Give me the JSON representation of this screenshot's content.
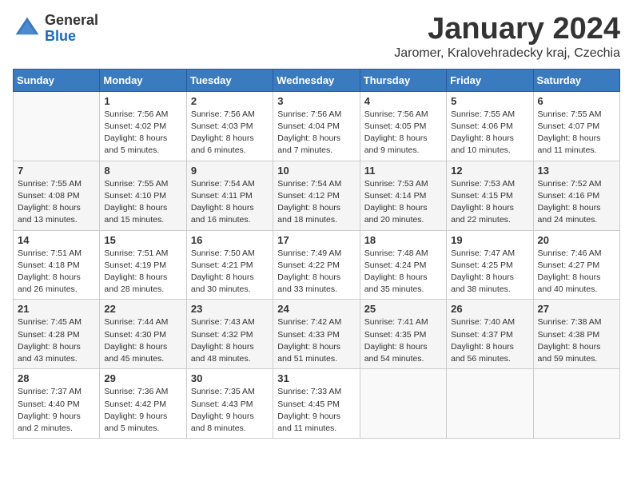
{
  "header": {
    "logo_general": "General",
    "logo_blue": "Blue",
    "title": "January 2024",
    "subtitle": "Jaromer, Kralovehradecky kraj, Czechia"
  },
  "calendar": {
    "days_of_week": [
      "Sunday",
      "Monday",
      "Tuesday",
      "Wednesday",
      "Thursday",
      "Friday",
      "Saturday"
    ],
    "weeks": [
      [
        {
          "day": "",
          "info": ""
        },
        {
          "day": "1",
          "info": "Sunrise: 7:56 AM\nSunset: 4:02 PM\nDaylight: 8 hours\nand 5 minutes."
        },
        {
          "day": "2",
          "info": "Sunrise: 7:56 AM\nSunset: 4:03 PM\nDaylight: 8 hours\nand 6 minutes."
        },
        {
          "day": "3",
          "info": "Sunrise: 7:56 AM\nSunset: 4:04 PM\nDaylight: 8 hours\nand 7 minutes."
        },
        {
          "day": "4",
          "info": "Sunrise: 7:56 AM\nSunset: 4:05 PM\nDaylight: 8 hours\nand 9 minutes."
        },
        {
          "day": "5",
          "info": "Sunrise: 7:55 AM\nSunset: 4:06 PM\nDaylight: 8 hours\nand 10 minutes."
        },
        {
          "day": "6",
          "info": "Sunrise: 7:55 AM\nSunset: 4:07 PM\nDaylight: 8 hours\nand 11 minutes."
        }
      ],
      [
        {
          "day": "7",
          "info": "Sunrise: 7:55 AM\nSunset: 4:08 PM\nDaylight: 8 hours\nand 13 minutes."
        },
        {
          "day": "8",
          "info": "Sunrise: 7:55 AM\nSunset: 4:10 PM\nDaylight: 8 hours\nand 15 minutes."
        },
        {
          "day": "9",
          "info": "Sunrise: 7:54 AM\nSunset: 4:11 PM\nDaylight: 8 hours\nand 16 minutes."
        },
        {
          "day": "10",
          "info": "Sunrise: 7:54 AM\nSunset: 4:12 PM\nDaylight: 8 hours\nand 18 minutes."
        },
        {
          "day": "11",
          "info": "Sunrise: 7:53 AM\nSunset: 4:14 PM\nDaylight: 8 hours\nand 20 minutes."
        },
        {
          "day": "12",
          "info": "Sunrise: 7:53 AM\nSunset: 4:15 PM\nDaylight: 8 hours\nand 22 minutes."
        },
        {
          "day": "13",
          "info": "Sunrise: 7:52 AM\nSunset: 4:16 PM\nDaylight: 8 hours\nand 24 minutes."
        }
      ],
      [
        {
          "day": "14",
          "info": "Sunrise: 7:51 AM\nSunset: 4:18 PM\nDaylight: 8 hours\nand 26 minutes."
        },
        {
          "day": "15",
          "info": "Sunrise: 7:51 AM\nSunset: 4:19 PM\nDaylight: 8 hours\nand 28 minutes."
        },
        {
          "day": "16",
          "info": "Sunrise: 7:50 AM\nSunset: 4:21 PM\nDaylight: 8 hours\nand 30 minutes."
        },
        {
          "day": "17",
          "info": "Sunrise: 7:49 AM\nSunset: 4:22 PM\nDaylight: 8 hours\nand 33 minutes."
        },
        {
          "day": "18",
          "info": "Sunrise: 7:48 AM\nSunset: 4:24 PM\nDaylight: 8 hours\nand 35 minutes."
        },
        {
          "day": "19",
          "info": "Sunrise: 7:47 AM\nSunset: 4:25 PM\nDaylight: 8 hours\nand 38 minutes."
        },
        {
          "day": "20",
          "info": "Sunrise: 7:46 AM\nSunset: 4:27 PM\nDaylight: 8 hours\nand 40 minutes."
        }
      ],
      [
        {
          "day": "21",
          "info": "Sunrise: 7:45 AM\nSunset: 4:28 PM\nDaylight: 8 hours\nand 43 minutes."
        },
        {
          "day": "22",
          "info": "Sunrise: 7:44 AM\nSunset: 4:30 PM\nDaylight: 8 hours\nand 45 minutes."
        },
        {
          "day": "23",
          "info": "Sunrise: 7:43 AM\nSunset: 4:32 PM\nDaylight: 8 hours\nand 48 minutes."
        },
        {
          "day": "24",
          "info": "Sunrise: 7:42 AM\nSunset: 4:33 PM\nDaylight: 8 hours\nand 51 minutes."
        },
        {
          "day": "25",
          "info": "Sunrise: 7:41 AM\nSunset: 4:35 PM\nDaylight: 8 hours\nand 54 minutes."
        },
        {
          "day": "26",
          "info": "Sunrise: 7:40 AM\nSunset: 4:37 PM\nDaylight: 8 hours\nand 56 minutes."
        },
        {
          "day": "27",
          "info": "Sunrise: 7:38 AM\nSunset: 4:38 PM\nDaylight: 8 hours\nand 59 minutes."
        }
      ],
      [
        {
          "day": "28",
          "info": "Sunrise: 7:37 AM\nSunset: 4:40 PM\nDaylight: 9 hours\nand 2 minutes."
        },
        {
          "day": "29",
          "info": "Sunrise: 7:36 AM\nSunset: 4:42 PM\nDaylight: 9 hours\nand 5 minutes."
        },
        {
          "day": "30",
          "info": "Sunrise: 7:35 AM\nSunset: 4:43 PM\nDaylight: 9 hours\nand 8 minutes."
        },
        {
          "day": "31",
          "info": "Sunrise: 7:33 AM\nSunset: 4:45 PM\nDaylight: 9 hours\nand 11 minutes."
        },
        {
          "day": "",
          "info": ""
        },
        {
          "day": "",
          "info": ""
        },
        {
          "day": "",
          "info": ""
        }
      ]
    ]
  }
}
